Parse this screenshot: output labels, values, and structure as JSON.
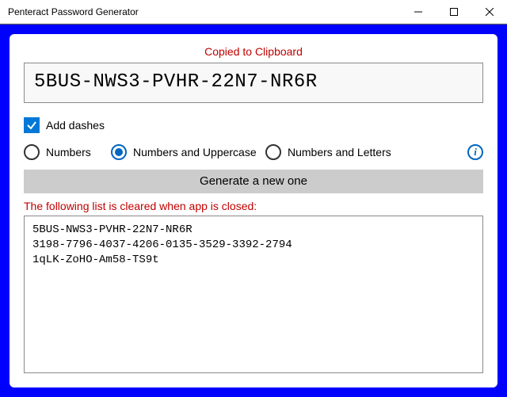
{
  "window": {
    "title": "Penteract Password Generator"
  },
  "status": "Copied to Clipboard",
  "password": "5BUS-NWS3-PVHR-22N7-NR6R",
  "options": {
    "add_dashes": {
      "label": "Add dashes",
      "checked": true
    },
    "radios": [
      {
        "label": "Numbers",
        "selected": false
      },
      {
        "label": "Numbers and Uppercase",
        "selected": true
      },
      {
        "label": "Numbers and Letters",
        "selected": false
      }
    ]
  },
  "generate_button": "Generate a new one",
  "history_note": "The following list is cleared when app is closed:",
  "history": [
    "5BUS-NWS3-PVHR-22N7-NR6R",
    "3198-7796-4037-4206-0135-3529-3392-2794",
    "1qLK-ZoHO-Am58-TS9t"
  ]
}
